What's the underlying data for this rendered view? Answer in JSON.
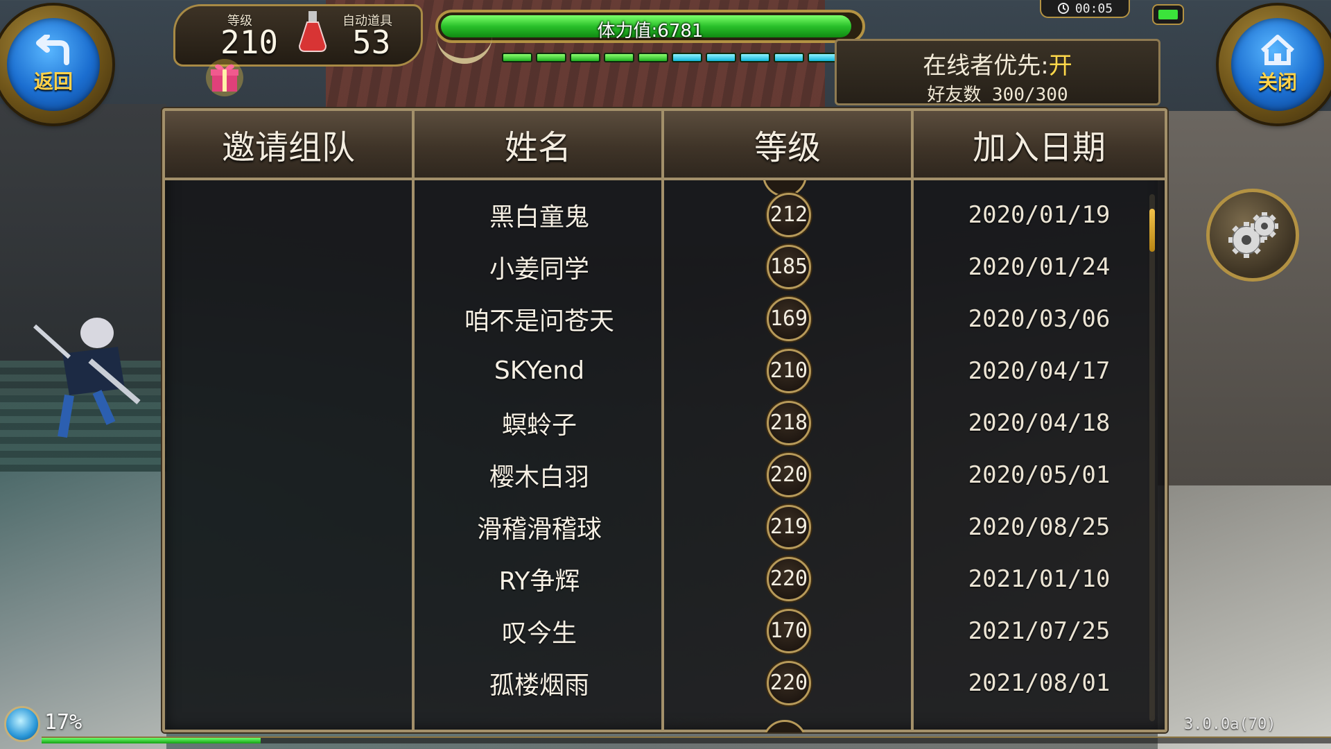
{
  "top_left": {
    "back_label": "返回",
    "level_label": "等级",
    "level_value": "210",
    "auto_item_label": "自动道具",
    "auto_item_value": "53"
  },
  "stamina": {
    "text": "体力值:6781",
    "fill_fraction": 0.98,
    "segments": [
      "green",
      "green",
      "green",
      "green",
      "green",
      "cyan",
      "cyan",
      "cyan",
      "cyan",
      "cyan"
    ]
  },
  "status_bar": {
    "clock": "00:05"
  },
  "online_panel": {
    "priority_label": "在线者优先:",
    "priority_value": "开",
    "friend_count": "好友数 300/300"
  },
  "top_right": {
    "close_label": "关闭"
  },
  "table": {
    "columns": [
      "邀请组队",
      "姓名",
      "等级",
      "加入日期"
    ],
    "rows": [
      {
        "name": "黑白童鬼",
        "level": "212",
        "date": "2020/01/19"
      },
      {
        "name": "小姜同学",
        "level": "185",
        "date": "2020/01/24"
      },
      {
        "name": "咱不是问苍天",
        "level": "169",
        "date": "2020/03/06"
      },
      {
        "name": "SKYend",
        "level": "210",
        "date": "2020/04/17"
      },
      {
        "name": "螟蛉子",
        "level": "218",
        "date": "2020/04/18"
      },
      {
        "name": "樱木白羽",
        "level": "220",
        "date": "2020/05/01"
      },
      {
        "name": "滑稽滑稽球",
        "level": "219",
        "date": "2020/08/25"
      },
      {
        "name": "RY争辉",
        "level": "220",
        "date": "2021/01/10"
      },
      {
        "name": "叹今生",
        "level": "170",
        "date": "2021/07/25"
      },
      {
        "name": "孤楼烟雨",
        "level": "220",
        "date": "2021/08/01"
      }
    ],
    "scroll_position_fraction": 0.03
  },
  "bottom": {
    "exp_percent_text": "17%",
    "exp_fraction": 0.17,
    "version": "3.0.0a(70)"
  },
  "icons": {
    "back": "back-arrow-icon",
    "close": "home-icon",
    "settings": "gear-icon",
    "gift": "gift-icon",
    "potion": "potion-icon",
    "clock": "clock-icon",
    "battery": "battery-icon",
    "exp": "exp-orb-icon"
  },
  "colors": {
    "frame_gold": "#a3906a",
    "button_blue": "#1b6ed0",
    "label_yellow": "#ffd24a",
    "stamina_green": "#29c02a",
    "segment_cyan": "#13b4d8"
  }
}
